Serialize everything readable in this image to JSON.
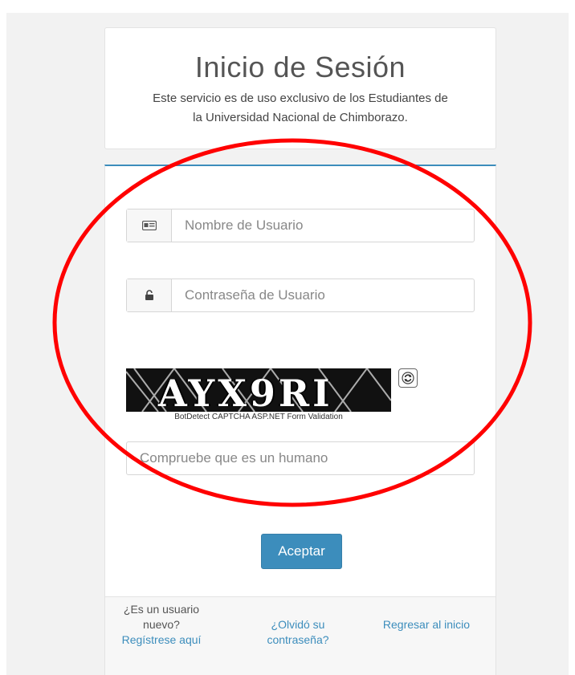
{
  "header": {
    "title": "Inicio de Sesión",
    "subtitle_line1": "Este servicio es de uso exclusivo de los Estudiantes de",
    "subtitle_line2": "la Universidad Nacional de Chimborazo."
  },
  "form": {
    "username_placeholder": "Nombre de Usuario",
    "password_placeholder": "Contraseña de Usuario",
    "captcha_text": "AYX9RI",
    "captcha_caption": "BotDetect CAPTCHA ASP.NET Form Validation",
    "human_placeholder": "Compruebe que es un humano",
    "submit_label": "Aceptar"
  },
  "footer": {
    "new_user_line1": "¿Es un usuario",
    "new_user_line2": "nuevo?",
    "register_link": "Regístrese aquí",
    "forgot_line1": "¿Olvidó su",
    "forgot_line2": "contraseña?",
    "back_link": "Regresar al inicio"
  },
  "colors": {
    "accent": "#3c8dbc",
    "annotation": "#ff0000"
  },
  "icons": {
    "username": "id-card-icon",
    "password": "unlock-icon",
    "captcha_reload": "reload-icon"
  }
}
